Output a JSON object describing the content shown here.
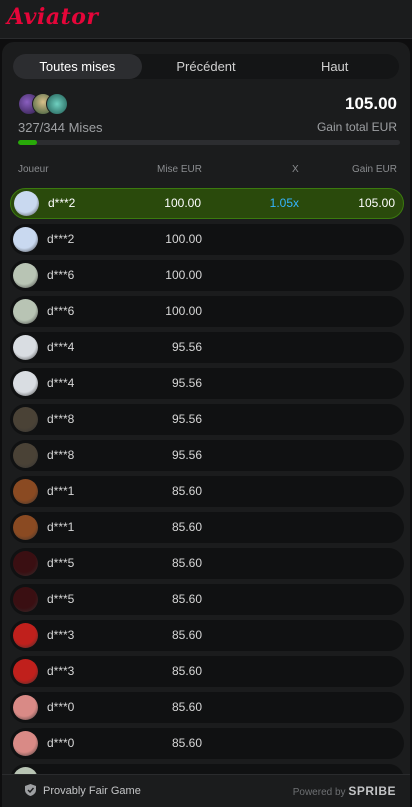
{
  "app": {
    "logo": "Aviator"
  },
  "tabs": [
    {
      "label": "Toutes mises",
      "active": true
    },
    {
      "label": "Précédent",
      "active": false
    },
    {
      "label": "Haut",
      "active": false
    }
  ],
  "summary": {
    "count_label": "327/344 Mises",
    "total": "105.00",
    "total_label": "Gain total EUR",
    "progress_fraction": 0.05
  },
  "columns": {
    "player": "Joueur",
    "bet": "Mise EUR",
    "mult": "X",
    "gain": "Gain EUR"
  },
  "rows": [
    {
      "player": "d***2",
      "bet": "100.00",
      "mult": "1.05x",
      "gain": "105.00",
      "avatar": "plane-red",
      "win": true
    },
    {
      "player": "d***2",
      "bet": "100.00",
      "mult": "",
      "gain": "",
      "avatar": "plane-red",
      "win": false
    },
    {
      "player": "d***6",
      "bet": "100.00",
      "mult": "",
      "gain": "",
      "avatar": "plane-green",
      "win": false
    },
    {
      "player": "d***6",
      "bet": "100.00",
      "mult": "",
      "gain": "",
      "avatar": "plane-green",
      "win": false
    },
    {
      "player": "d***4",
      "bet": "95.56",
      "mult": "",
      "gain": "",
      "avatar": "jet-grey",
      "win": false
    },
    {
      "player": "d***4",
      "bet": "95.56",
      "mult": "",
      "gain": "",
      "avatar": "jet-grey",
      "win": false
    },
    {
      "player": "d***8",
      "bet": "95.56",
      "mult": "",
      "gain": "",
      "avatar": "propeller",
      "win": false
    },
    {
      "player": "d***8",
      "bet": "95.56",
      "mult": "",
      "gain": "",
      "avatar": "propeller",
      "win": false
    },
    {
      "player": "d***1",
      "bet": "85.60",
      "mult": "",
      "gain": "",
      "avatar": "brown-orb",
      "win": false
    },
    {
      "player": "d***1",
      "bet": "85.60",
      "mult": "",
      "gain": "",
      "avatar": "brown-orb",
      "win": false
    },
    {
      "player": "d***5",
      "bet": "85.60",
      "mult": "",
      "gain": "",
      "avatar": "red-dark",
      "win": false
    },
    {
      "player": "d***5",
      "bet": "85.60",
      "mult": "",
      "gain": "",
      "avatar": "red-dark",
      "win": false
    },
    {
      "player": "d***3",
      "bet": "85.60",
      "mult": "",
      "gain": "",
      "avatar": "red-car",
      "win": false
    },
    {
      "player": "d***3",
      "bet": "85.60",
      "mult": "",
      "gain": "",
      "avatar": "red-car",
      "win": false
    },
    {
      "player": "d***0",
      "bet": "85.60",
      "mult": "",
      "gain": "",
      "avatar": "pink-plane",
      "win": false
    },
    {
      "player": "d***0",
      "bet": "85.60",
      "mult": "",
      "gain": "",
      "avatar": "pink-plane",
      "win": false
    },
    {
      "player": "",
      "bet": "",
      "mult": "",
      "gain": "",
      "avatar": "plane-green",
      "win": false
    }
  ],
  "avatar_colors": {
    "plane-red": "#c9d9f0",
    "plane-green": "#b8c4b4",
    "jet-grey": "#d9dde2",
    "propeller": "#4a4236",
    "brown-orb": "#8a4a22",
    "red-dark": "#3a0f12",
    "red-car": "#c0201c",
    "pink-plane": "#d98a86"
  },
  "footer": {
    "provably_fair": "Provably Fair Game",
    "powered_by": "Powered by",
    "brand": "SPRIBE"
  },
  "colors": {
    "accent": "#e50539",
    "win_row": "#2a4a0c",
    "multiplier": "#34b4ff",
    "progress": "#28a909"
  }
}
